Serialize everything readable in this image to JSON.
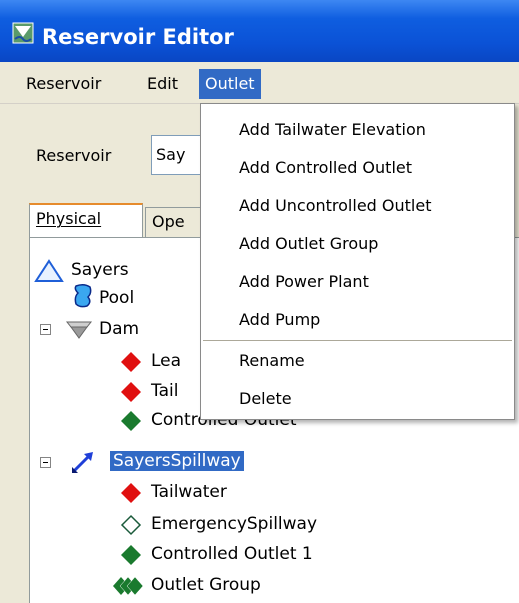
{
  "window": {
    "title": "Reservoir Editor"
  },
  "menubar": {
    "items": [
      "Reservoir",
      "Edit",
      "Outlet"
    ],
    "active": "Outlet"
  },
  "reservoir_selector": {
    "label": "Reservoir",
    "value": "Say"
  },
  "tabs": [
    {
      "label": "Physical",
      "selected": true
    },
    {
      "label": "Ope",
      "selected": false
    }
  ],
  "tree": {
    "root": "Sayers",
    "pool": "Pool",
    "dam": "Dam",
    "dam_children": [
      "Lea",
      "Tail",
      "Controlled Outlet"
    ],
    "spillway": "SayersSpillway",
    "spillway_children": [
      "Tailwater",
      "EmergencySpillway",
      "Controlled Outlet 1",
      "Outlet Group"
    ]
  },
  "outlet_menu": {
    "items": [
      "Add Tailwater Elevation",
      "Add Controlled Outlet",
      "Add Uncontrolled Outlet",
      "Add Outlet Group",
      "Add Power Plant",
      "Add Pump"
    ],
    "secondary": [
      "Rename",
      "Delete"
    ]
  },
  "colors": {
    "titlebar": "#0b52d6",
    "selection": "#316ac5",
    "tab_accent": "#e68b2c",
    "red_icon": "#e01010",
    "green_icon": "#1a7a2e"
  },
  "icons": [
    "reservoir-triangle-icon",
    "pool-icon",
    "dam-icon",
    "red-diamond-icon",
    "green-diamond-icon",
    "spillway-icon",
    "hollow-diamond-icon",
    "outlet-group-icon"
  ]
}
